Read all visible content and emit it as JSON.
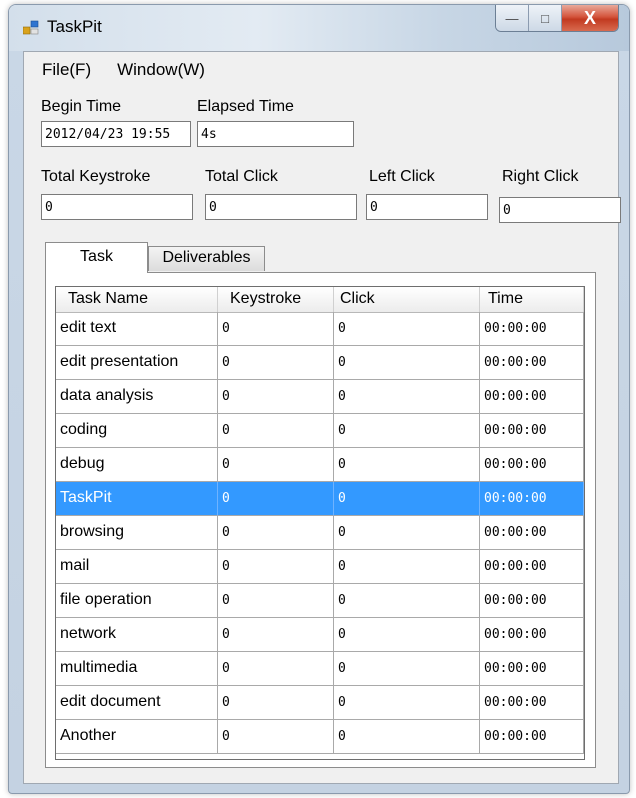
{
  "window": {
    "title": "TaskPit",
    "buttons": {
      "minimize": "—",
      "maximize": "□",
      "close": "X"
    }
  },
  "menu": [
    {
      "label": "File(F)"
    },
    {
      "label": "Window(W)"
    }
  ],
  "fields": {
    "begin_time": {
      "label": "Begin Time",
      "value": "2012/04/23 19:55"
    },
    "elapsed_time": {
      "label": "Elapsed Time",
      "value": "4s"
    },
    "total_keystroke": {
      "label": "Total Keystroke",
      "value": "0"
    },
    "total_click": {
      "label": "Total Click",
      "value": "0"
    },
    "left_click": {
      "label": "Left Click",
      "value": "0"
    },
    "right_click": {
      "label": "Right Click",
      "value": "0"
    }
  },
  "tabs": [
    {
      "label": "Task",
      "active": true
    },
    {
      "label": "Deliverables",
      "active": false
    }
  ],
  "grid": {
    "columns": [
      "Task Name",
      "Keystroke",
      "Click",
      "Time"
    ],
    "selected_index": 5,
    "rows": [
      [
        "edit text",
        "0",
        "0",
        "00:00:00"
      ],
      [
        "edit presentation",
        "0",
        "0",
        "00:00:00"
      ],
      [
        "data analysis",
        "0",
        "0",
        "00:00:00"
      ],
      [
        "coding",
        "0",
        "0",
        "00:00:00"
      ],
      [
        "debug",
        "0",
        "0",
        "00:00:00"
      ],
      [
        "TaskPit",
        "0",
        "0",
        "00:00:00"
      ],
      [
        "browsing",
        "0",
        "0",
        "00:00:00"
      ],
      [
        "mail",
        "0",
        "0",
        "00:00:00"
      ],
      [
        "file operation",
        "0",
        "0",
        "00:00:00"
      ],
      [
        "network",
        "0",
        "0",
        "00:00:00"
      ],
      [
        "multimedia",
        "0",
        "0",
        "00:00:00"
      ],
      [
        "edit document",
        "0",
        "0",
        "00:00:00"
      ],
      [
        "Another",
        "0",
        "0",
        "00:00:00"
      ]
    ]
  },
  "colors": {
    "selection": "#3399ff",
    "client_bg": "#f0f0f0",
    "close_button": "#c23a20"
  }
}
